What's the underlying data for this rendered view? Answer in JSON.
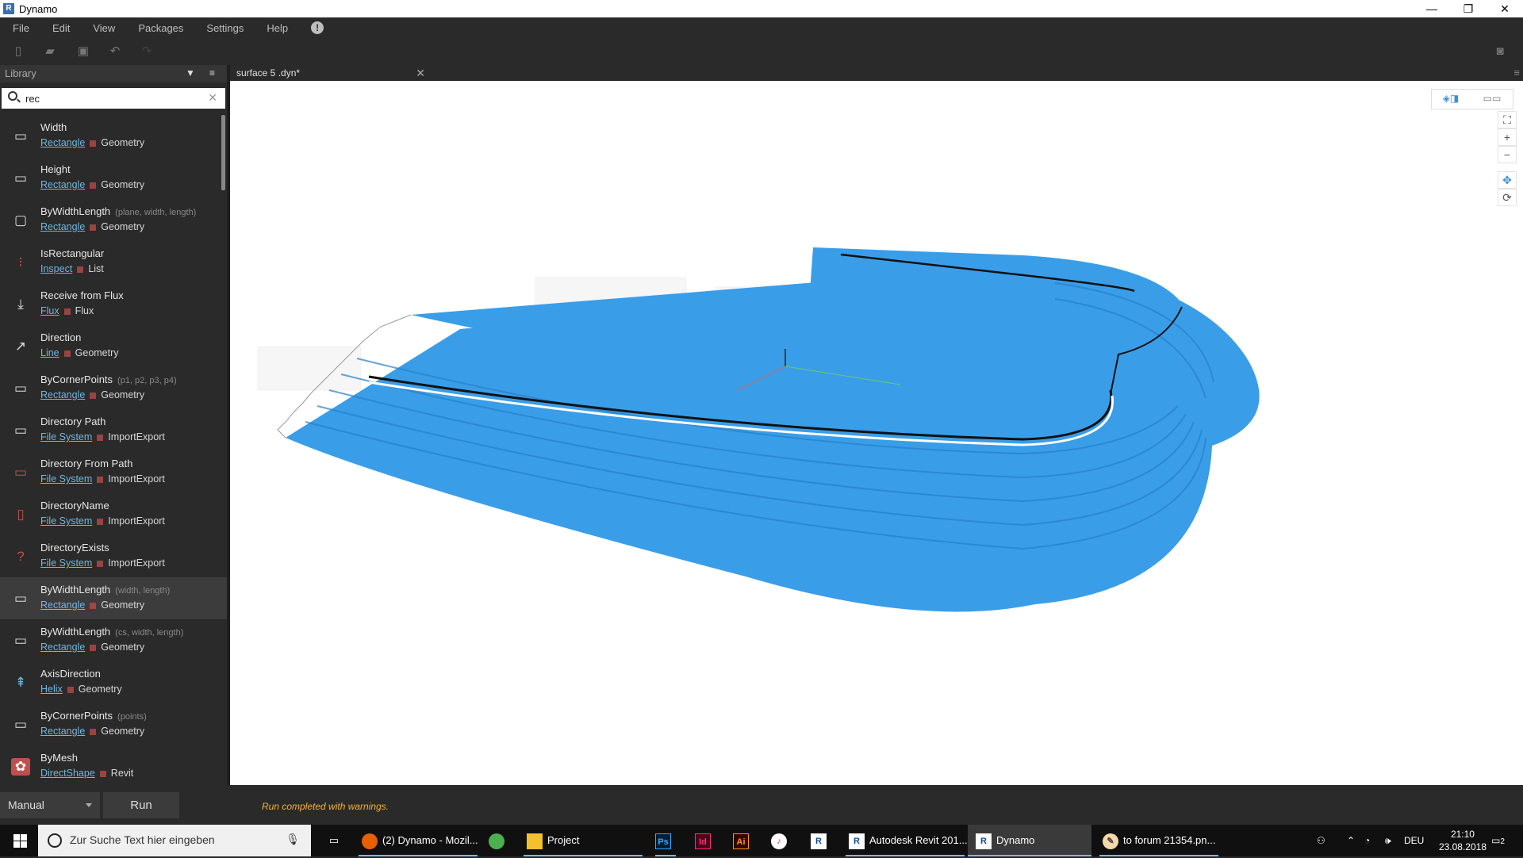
{
  "window": {
    "title": "Dynamo",
    "minimize": "—",
    "restore": "❐",
    "close": "✕"
  },
  "menu": [
    "File",
    "Edit",
    "View",
    "Packages",
    "Settings",
    "Help"
  ],
  "library": {
    "title": "Library",
    "search_value": "rec",
    "items": [
      {
        "name": "Width",
        "params": "",
        "cat1": "Rectangle",
        "cat2": "Geometry",
        "icon": "▭"
      },
      {
        "name": "Height",
        "params": "",
        "cat1": "Rectangle",
        "cat2": "Geometry",
        "icon": "▭"
      },
      {
        "name": "ByWidthLength",
        "params": "(plane, width, length)",
        "cat1": "Rectangle",
        "cat2": "Geometry",
        "icon": "▢"
      },
      {
        "name": "IsRectangular",
        "params": "",
        "cat1": "Inspect",
        "cat2": "List",
        "icon": "⁝"
      },
      {
        "name": "Receive from Flux",
        "params": "",
        "cat1": "Flux",
        "cat2": "Flux",
        "icon": "⤓"
      },
      {
        "name": "Direction",
        "params": "",
        "cat1": "Line",
        "cat2": "Geometry",
        "icon": "↗"
      },
      {
        "name": "ByCornerPoints",
        "params": "(p1, p2, p3, p4)",
        "cat1": "Rectangle",
        "cat2": "Geometry",
        "icon": "▭"
      },
      {
        "name": "Directory Path",
        "params": "",
        "cat1": "File System",
        "cat2": "ImportExport",
        "icon": "▭"
      },
      {
        "name": "Directory From Path",
        "params": "",
        "cat1": "File System",
        "cat2": "ImportExport",
        "icon": "▭"
      },
      {
        "name": "DirectoryName",
        "params": "",
        "cat1": "File System",
        "cat2": "ImportExport",
        "icon": "▯"
      },
      {
        "name": "DirectoryExists",
        "params": "",
        "cat1": "File System",
        "cat2": "ImportExport",
        "icon": "?"
      },
      {
        "name": "ByWidthLength",
        "params": "(width, length)",
        "cat1": "Rectangle",
        "cat2": "Geometry",
        "icon": "▭"
      },
      {
        "name": "ByWidthLength",
        "params": "(cs, width, length)",
        "cat1": "Rectangle",
        "cat2": "Geometry",
        "icon": "▭"
      },
      {
        "name": "AxisDirection",
        "params": "",
        "cat1": "Helix",
        "cat2": "Geometry",
        "icon": "⇞"
      },
      {
        "name": "ByCornerPoints",
        "params": "(points)",
        "cat1": "Rectangle",
        "cat2": "Geometry",
        "icon": "▭"
      },
      {
        "name": "ByMesh",
        "params": "",
        "cat1": "DirectShape",
        "cat2": "Revit",
        "icon": "✿"
      }
    ]
  },
  "tab": {
    "title": "surface 5 .dyn*",
    "close": "✕"
  },
  "run": {
    "mode": "Manual",
    "button": "Run",
    "status": "Run completed with warnings."
  },
  "taskbar": {
    "search_placeholder": "Zur Suche Text hier eingeben",
    "apps": [
      {
        "label": "(2) Dynamo - Mozil...",
        "icon": "firefox-icon"
      },
      {
        "label": "",
        "icon": "chrome-icon"
      },
      {
        "label": "Project",
        "icon": "folder-icon"
      },
      {
        "label": "Ps",
        "icon": "photoshop-icon"
      },
      {
        "label": "Id",
        "icon": "indesign-icon"
      },
      {
        "label": "Ai",
        "icon": "illustrator-icon"
      },
      {
        "label": "",
        "icon": "itunes-icon"
      },
      {
        "label": "R",
        "icon": "revit-icon"
      },
      {
        "label": "Autodesk Revit 201...",
        "icon": "revit-icon"
      },
      {
        "label": "Dynamo",
        "icon": "revit-icon"
      },
      {
        "label": "to forum 21354.pn...",
        "icon": "paint-icon"
      }
    ],
    "lang": "DEU",
    "time": "21:10",
    "date": "23.08.2018",
    "notif_count": "2"
  },
  "colors": {
    "geometry": "#3a9de8",
    "status": "#f2b230",
    "link": "#6fb7e0"
  }
}
